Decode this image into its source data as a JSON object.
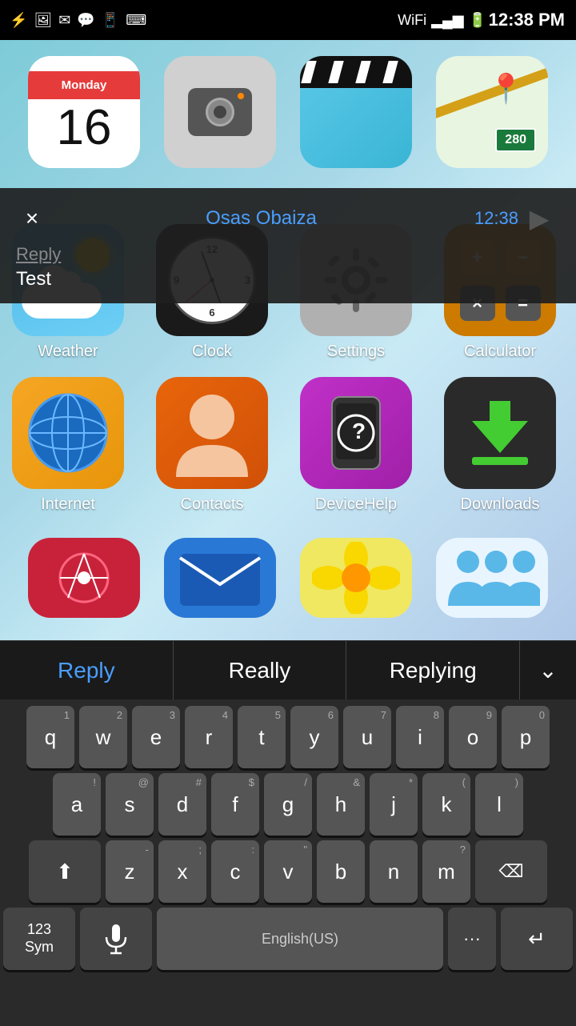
{
  "statusBar": {
    "time": "12:38 PM",
    "icons": [
      "usb",
      "image",
      "email",
      "chat",
      "phone",
      "keyboard"
    ],
    "signal": "wifi+bars",
    "battery": "charging"
  },
  "notification": {
    "sender": "Osas Obaiza",
    "time": "12:38",
    "replyPlaceholder": "Reply",
    "message": "Test",
    "closeLabel": "×",
    "sendLabel": "▶"
  },
  "apps": {
    "row1": [
      {
        "name": "Calendar",
        "label": "",
        "day": "16",
        "month": "Monday"
      },
      {
        "name": "Camera",
        "label": ""
      },
      {
        "name": "Video",
        "label": ""
      },
      {
        "name": "Maps",
        "label": ""
      }
    ],
    "row2": [
      {
        "id": "weather",
        "label": "Weather"
      },
      {
        "id": "clock",
        "label": "Clock"
      },
      {
        "id": "settings",
        "label": "Settings"
      },
      {
        "id": "calculator",
        "label": "Calculator"
      }
    ],
    "row3": [
      {
        "id": "internet",
        "label": "Internet"
      },
      {
        "id": "contacts",
        "label": "Contacts"
      },
      {
        "id": "devicehelp",
        "label": "DeviceHelp"
      },
      {
        "id": "downloads",
        "label": "Downloads"
      }
    ],
    "row4": [
      {
        "id": "network",
        "label": ""
      },
      {
        "id": "mail",
        "label": ""
      },
      {
        "id": "flower",
        "label": ""
      },
      {
        "id": "family",
        "label": ""
      }
    ]
  },
  "autocorrect": {
    "option1": "Reply",
    "option2": "Really",
    "option3": "Replying",
    "chevron": "⌄"
  },
  "keyboard": {
    "rows": [
      [
        {
          "key": "q",
          "num": "1"
        },
        {
          "key": "w",
          "num": "2"
        },
        {
          "key": "e",
          "num": "3"
        },
        {
          "key": "r",
          "num": "4"
        },
        {
          "key": "t",
          "num": "5"
        },
        {
          "key": "y",
          "num": "6"
        },
        {
          "key": "u",
          "num": "7"
        },
        {
          "key": "i",
          "num": "8"
        },
        {
          "key": "o",
          "num": "9"
        },
        {
          "key": "p",
          "num": "0"
        }
      ],
      [
        {
          "key": "a",
          "num": "!"
        },
        {
          "key": "s",
          "num": "@"
        },
        {
          "key": "d",
          "num": "#"
        },
        {
          "key": "f",
          "num": "$"
        },
        {
          "key": "g",
          "num": "/"
        },
        {
          "key": "h",
          "num": "&"
        },
        {
          "key": "j",
          "num": "*"
        },
        {
          "key": "k",
          "num": "("
        },
        {
          "key": "l",
          "num": ")"
        }
      ],
      [
        {
          "key": "z",
          "num": "-"
        },
        {
          "key": "x",
          "num": ";"
        },
        {
          "key": "c",
          "num": ":"
        },
        {
          "key": "v",
          "num": "\""
        },
        {
          "key": "b",
          "num": ""
        },
        {
          "key": "n",
          "num": ""
        },
        {
          "key": "m",
          "num": "?"
        }
      ]
    ],
    "shiftLabel": "⬆",
    "backspaceLabel": "⌫",
    "numbersLabel": "123\nSym",
    "micLabel": "🎤",
    "spaceLabel": "English(US)",
    "dotsLabel": "···",
    "enterLabel": "↵"
  }
}
